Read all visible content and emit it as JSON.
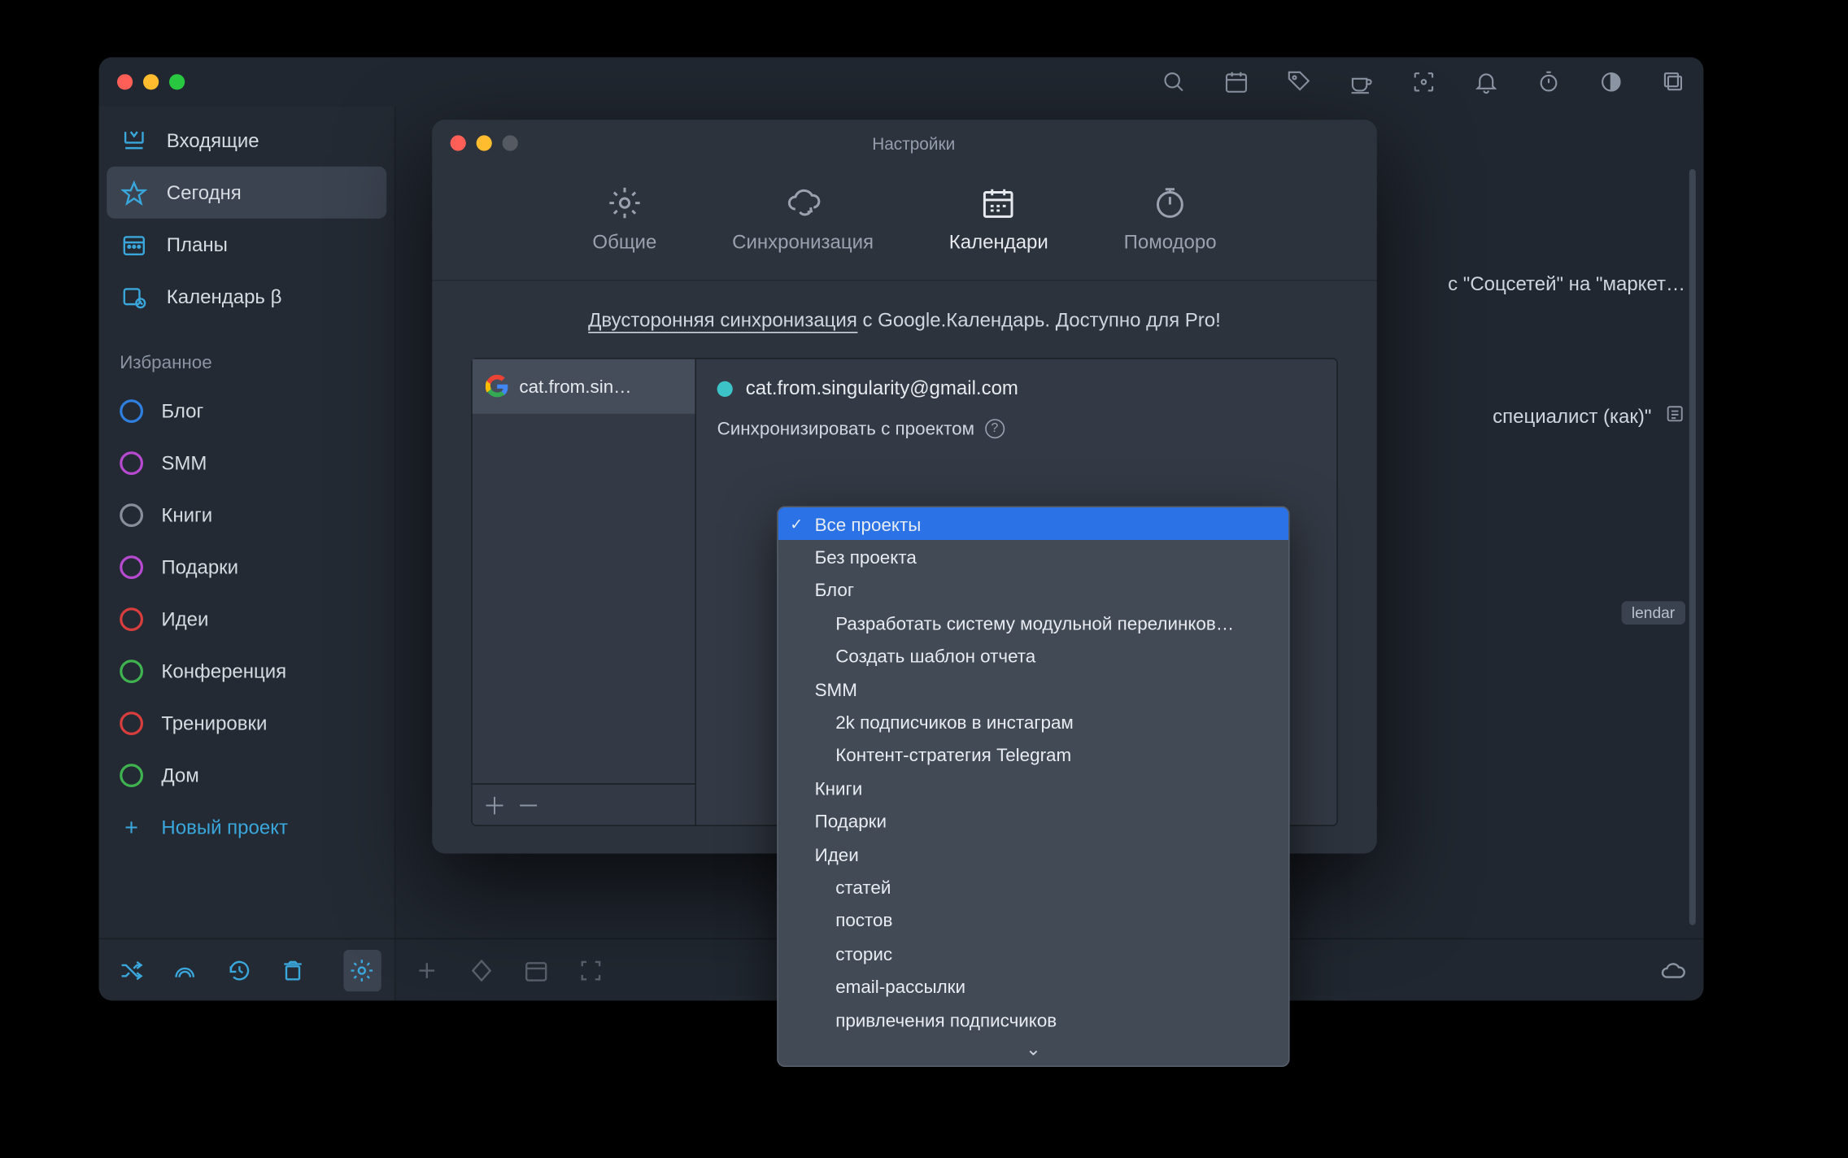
{
  "main_window": {
    "nav": {
      "inbox": "Входящие",
      "today": "Сегодня",
      "plans": "Планы",
      "calendar": "Календарь β"
    },
    "section_fav": "Избранное",
    "projects": [
      {
        "name": "Блог",
        "color": "#2e7fe0"
      },
      {
        "name": "SMM",
        "color": "#b74ad1"
      },
      {
        "name": "Книги",
        "color": "#888f9b"
      },
      {
        "name": "Подарки",
        "color": "#b74ad1"
      },
      {
        "name": "Идеи",
        "color": "#d93e3e"
      },
      {
        "name": "Конференция",
        "color": "#3fb34f"
      },
      {
        "name": "Тренировки",
        "color": "#d93e3e"
      },
      {
        "name": "Дом",
        "color": "#3fb34f"
      }
    ],
    "new_project": "Новый проект",
    "tasks": {
      "t1": "с \"Соцсетей\" на \"маркет…",
      "t2": "специалист (как)\"",
      "badge": "lendar"
    }
  },
  "settings": {
    "title": "Настройки",
    "tabs": {
      "general": "Общие",
      "sync": "Синхронизация",
      "calendars": "Календари",
      "pomodoro": "Помодоро"
    },
    "sync_msg_underlined": "Двусторонняя синхронизация",
    "sync_msg_rest": " с Google.Календарь. Доступно для Pro!",
    "account_short": "cat.from.sin…",
    "account_full": "cat.from.singularity@gmail.com",
    "sync_with_project": "Синхронизировать с проектом"
  },
  "dropdown": {
    "items": [
      {
        "label": "Все проекты",
        "selected": true,
        "indent": 0
      },
      {
        "label": "Без проекта",
        "indent": 0
      },
      {
        "label": "Блог",
        "indent": 0
      },
      {
        "label": "Разработать систему модульной перелинков…",
        "indent": 1
      },
      {
        "label": "Создать шаблон отчета",
        "indent": 1
      },
      {
        "label": "SMM",
        "indent": 0
      },
      {
        "label": "2k подписчиков в инстаграм",
        "indent": 1
      },
      {
        "label": "Контент-стратегия Telegram",
        "indent": 1
      },
      {
        "label": "Книги",
        "indent": 0
      },
      {
        "label": "Подарки",
        "indent": 0
      },
      {
        "label": "Идеи",
        "indent": 0
      },
      {
        "label": "статей",
        "indent": 1
      },
      {
        "label": "постов",
        "indent": 1
      },
      {
        "label": "сторис",
        "indent": 1
      },
      {
        "label": "email-рассылки",
        "indent": 1
      },
      {
        "label": "привлечения подписчиков",
        "indent": 1
      }
    ]
  }
}
